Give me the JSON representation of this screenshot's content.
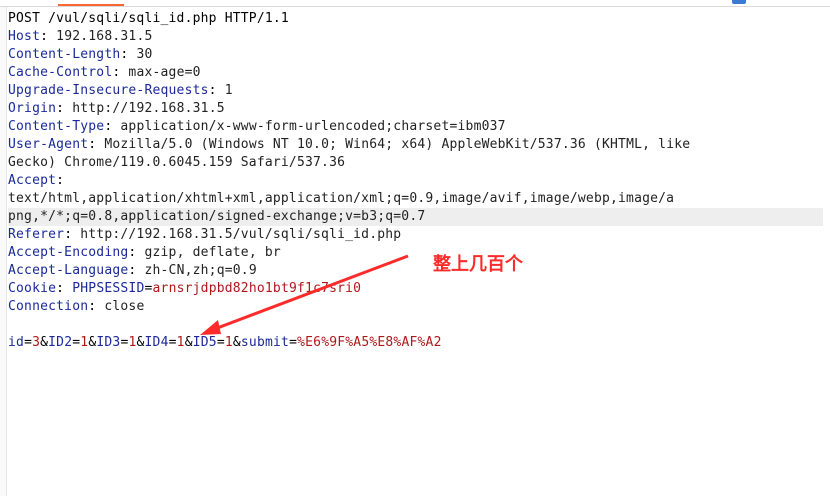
{
  "request": {
    "request_line": "POST /vul/sqli/sqli_id.php HTTP/1.1",
    "headers": [
      {
        "name": "Host",
        "value": "192.168.31.5"
      },
      {
        "name": "Content-Length",
        "value": "30"
      },
      {
        "name": "Cache-Control",
        "value": "max-age=0"
      },
      {
        "name": "Upgrade-Insecure-Requests",
        "value": "1"
      },
      {
        "name": "Origin",
        "value": "http://192.168.31.5"
      },
      {
        "name": "Content-Type",
        "value": "application/x-www-form-urlencoded;charset=ibm037"
      },
      {
        "name": "User-Agent",
        "value": "Mozilla/5.0 (Windows NT 10.0; Win64; x64) AppleWebKit/537.36 (KHTML, like",
        "value_cont": "Gecko) Chrome/119.0.6045.159 Safari/537.36"
      },
      {
        "name": "Accept",
        "value": "",
        "value_cont": "text/html,application/xhtml+xml,application/xml;q=0.9,image/avif,image/webp,image/a",
        "value_cont2": "png,*/*;q=0.8,application/signed-exchange;v=b3;q=0.7"
      },
      {
        "name": "Referer",
        "value": "http://192.168.31.5/vul/sqli/sqli_id.php"
      },
      {
        "name": "Accept-Encoding",
        "value": "gzip, deflate, br"
      },
      {
        "name": "Accept-Language",
        "value": "zh-CN,zh;q=0.9"
      },
      {
        "name": "Cookie",
        "value": ""
      },
      {
        "name": "Connection",
        "value": "close"
      }
    ],
    "cookie": {
      "name": "PHPSESSID",
      "value": "arnsrjdpbd82ho1bt9f1c7sri0"
    },
    "body_params": [
      {
        "name": "id",
        "value": "3"
      },
      {
        "name": "ID2",
        "value": "1"
      },
      {
        "name": "ID3",
        "value": "1"
      },
      {
        "name": "ID4",
        "value": "1"
      },
      {
        "name": "ID5",
        "value": "1"
      },
      {
        "name": "submit",
        "value": "%E6%9F%A5%E8%AF%A2"
      }
    ]
  },
  "annotation": {
    "text": "整上几百个",
    "color": "#ff2b2b"
  },
  "colors": {
    "header_key": "#1a2a99",
    "cookie_value": "#b01818",
    "tab_accent": "#ff6633"
  }
}
